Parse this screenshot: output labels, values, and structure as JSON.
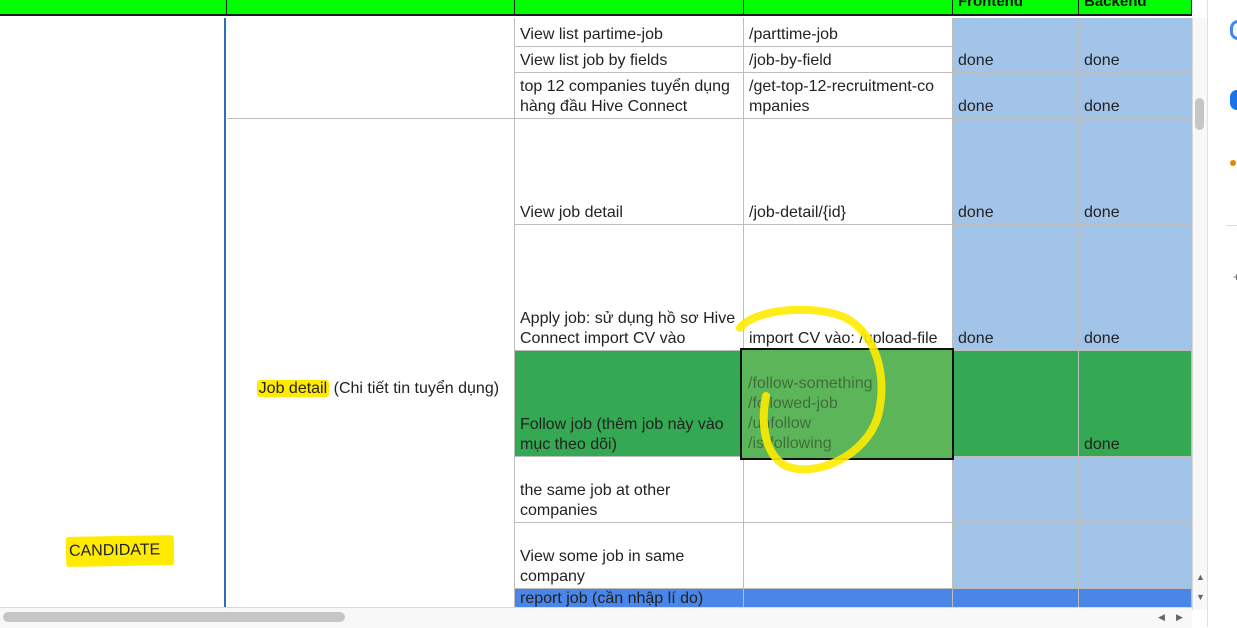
{
  "columns": {
    "frontend": "Frontend",
    "backend": "Backend"
  },
  "role_label": "CANDIDATE",
  "section": {
    "label_highlight": "Job detail",
    "label_rest": " (Chi tiết tin tuyển dụng)"
  },
  "rows": [
    {
      "feature": "View list partime-job",
      "endpoint": "/parttime-job",
      "frontend": "",
      "backend": ""
    },
    {
      "feature": "View list job by fields",
      "endpoint": "/job-by-field",
      "frontend": "done",
      "backend": "done"
    },
    {
      "feature": "top 12 companies tuyển dụng hàng đầu Hive Connect",
      "endpoint": "/get-top-12-recruitment-companies",
      "frontend": "done",
      "backend": "done"
    },
    {
      "feature": "View job detail",
      "endpoint": "/job-detail/{id}",
      "frontend": "done",
      "backend": "done"
    },
    {
      "feature": "Apply job: sử dụng hồ sơ Hive Connect import CV vào",
      "endpoint": "import CV vào: /upload-file",
      "frontend": "done",
      "backend": "done"
    },
    {
      "feature": "Follow job (thêm job này vào mục theo dõi)",
      "endpoint": "/follow-something\n/followed-job\n/unfollow\n/is-following",
      "frontend": "",
      "backend": "done"
    },
    {
      "feature": "the same job at other companies",
      "endpoint": "",
      "frontend": "",
      "backend": ""
    },
    {
      "feature": "View some job in same company",
      "endpoint": "",
      "frontend": "",
      "backend": ""
    },
    {
      "feature": "report job (cần nhập lí do)",
      "endpoint": "",
      "frontend": "",
      "backend": ""
    }
  ],
  "colors": {
    "header": "#00ff00",
    "done_cell": "#a2c4e9",
    "follow_row": "#34a853",
    "report_row": "#4a86e8",
    "highlight": "#ffeb00"
  }
}
